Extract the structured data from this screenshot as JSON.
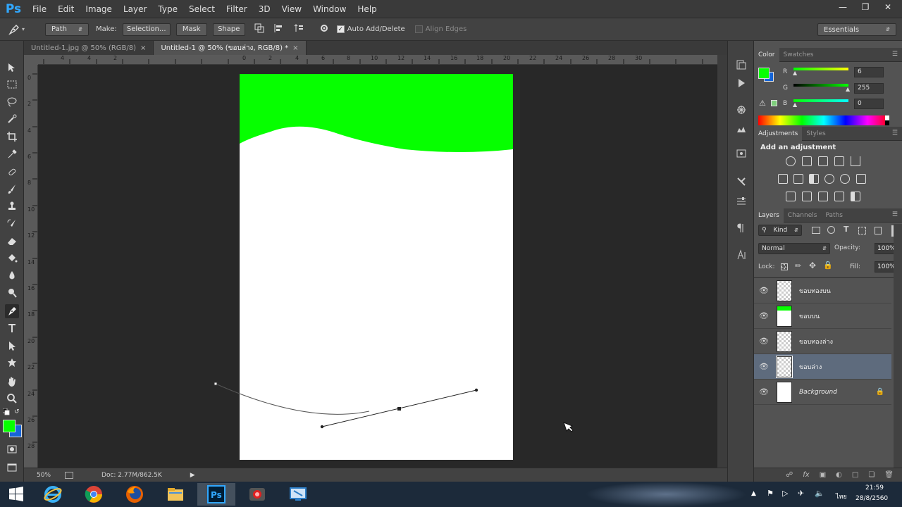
{
  "app": {
    "logo": "Ps"
  },
  "menu": [
    "File",
    "Edit",
    "Image",
    "Layer",
    "Type",
    "Select",
    "Filter",
    "3D",
    "View",
    "Window",
    "Help"
  ],
  "window_controls": [
    "minimize",
    "restore",
    "close"
  ],
  "options": {
    "mode": "Path",
    "make_label": "Make:",
    "selection": "Selection...",
    "mask": "Mask",
    "shape": "Shape",
    "auto_add_delete": "Auto Add/Delete",
    "auto_add_delete_checked": true,
    "align_edges": "Align Edges",
    "align_edges_checked": false,
    "workspace": "Essentials"
  },
  "tabs": [
    {
      "label": "Untitled-1.jpg @ 50% (RGB/8)",
      "active": false
    },
    {
      "label": "Untitled-1 @ 50% (ขอบล่าง, RGB/8) *",
      "active": true
    }
  ],
  "ruler_top": [
    "6",
    "4",
    "2",
    "0",
    "2",
    "4",
    "6",
    "8",
    "10",
    "12",
    "14",
    "16",
    "18",
    "20",
    "22",
    "24",
    "26",
    "28",
    "30"
  ],
  "ruler_left": [
    "0",
    "2",
    "4",
    "6",
    "8",
    "10",
    "12",
    "14",
    "16",
    "18",
    "20",
    "22",
    "24",
    "26",
    "28"
  ],
  "status": {
    "zoom": "50%",
    "doc": "Doc: 2.77M/862.5K"
  },
  "color_panel": {
    "tabs": [
      "Color",
      "Swatches"
    ],
    "fg_color": "#06ff00",
    "bg_color": "#1565d8",
    "r_label": "R",
    "r_value": "6",
    "g_label": "G",
    "g_value": "255",
    "b_label": "B",
    "b_value": "0"
  },
  "adjustments_panel": {
    "tabs": [
      "Adjustments",
      "Styles"
    ],
    "heading": "Add an adjustment"
  },
  "layers_panel": {
    "tabs": [
      "Layers",
      "Channels",
      "Paths"
    ],
    "kind": "Kind",
    "blend_mode": "Normal",
    "opacity_label": "Opacity:",
    "opacity_value": "100%",
    "lock_label": "Lock:",
    "fill_label": "Fill:",
    "fill_value": "100%",
    "layers": [
      {
        "name": "ขอบทองบน",
        "selected": false,
        "thumb": "transparent"
      },
      {
        "name": "ขอบบน",
        "selected": false,
        "thumb": "green-wave"
      },
      {
        "name": "ขอบทองล่าง",
        "selected": false,
        "thumb": "transparent"
      },
      {
        "name": "ขอบล่าง",
        "selected": true,
        "thumb": "transparent"
      },
      {
        "name": "Background",
        "selected": false,
        "thumb": "white",
        "locked": true
      }
    ]
  },
  "taskbar": {
    "apps": [
      "start",
      "internet-explorer",
      "chrome",
      "firefox",
      "file-explorer",
      "photoshop",
      "recorder",
      "remote-desktop"
    ],
    "lang": "ไทย",
    "time": "21:59",
    "date": "28/8/2560"
  },
  "colors": {
    "green": "#06ff00",
    "panel": "#535353",
    "dark": "#282828"
  }
}
